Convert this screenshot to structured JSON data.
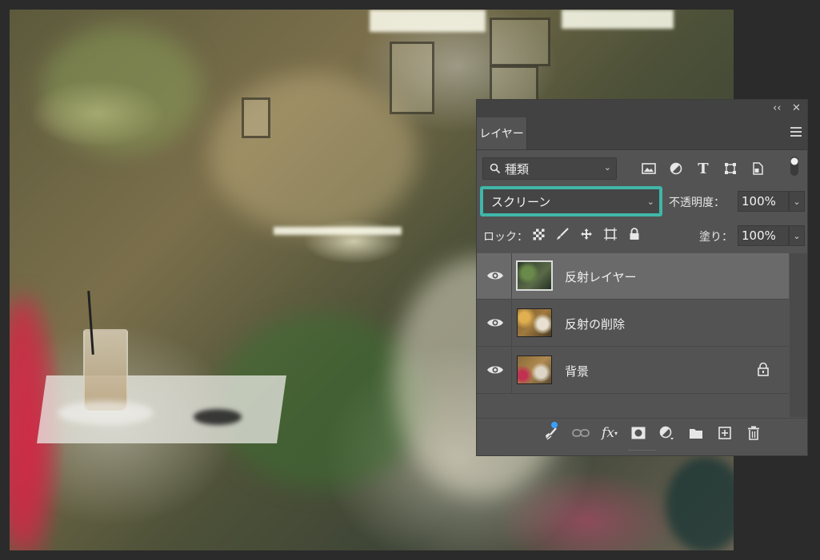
{
  "panel": {
    "collapse_icon": "double-chevron-left-icon",
    "close_icon": "close-icon",
    "tab_label": "レイヤー",
    "menu_icon": "hamburger-menu-icon"
  },
  "filter": {
    "kind_label": "種類",
    "icons": [
      "image-filter-icon",
      "adjustment-filter-icon",
      "type-filter-icon",
      "shape-filter-icon",
      "smart-object-filter-icon"
    ]
  },
  "blend": {
    "mode": "スクリーン",
    "highlight_color": "#3fb6a8",
    "opacity_label": "不透明度：",
    "opacity_value": "100%"
  },
  "lock": {
    "label": "ロック：",
    "icons": [
      "lock-transparent-pixels-icon",
      "lock-image-pixels-icon",
      "lock-position-icon",
      "lock-artboard-icon",
      "lock-all-icon"
    ],
    "fill_label": "塗り：",
    "fill_value": "100%"
  },
  "layers": [
    {
      "name": "反射レイヤー",
      "visible": true,
      "selected": true,
      "locked": false
    },
    {
      "name": "反射の削除",
      "visible": true,
      "selected": false,
      "locked": false
    },
    {
      "name": "背景",
      "visible": true,
      "selected": false,
      "locked": true
    }
  ],
  "bottom_icons": [
    "link-layers-icon",
    "fx-icon",
    "add-mask-icon",
    "new-adjustment-layer-icon",
    "new-group-icon",
    "new-layer-icon",
    "delete-icon"
  ],
  "colors": {
    "panel_bg": "#535353",
    "selected_row": "#6a6a6a",
    "badge": "#3aa0ff"
  }
}
